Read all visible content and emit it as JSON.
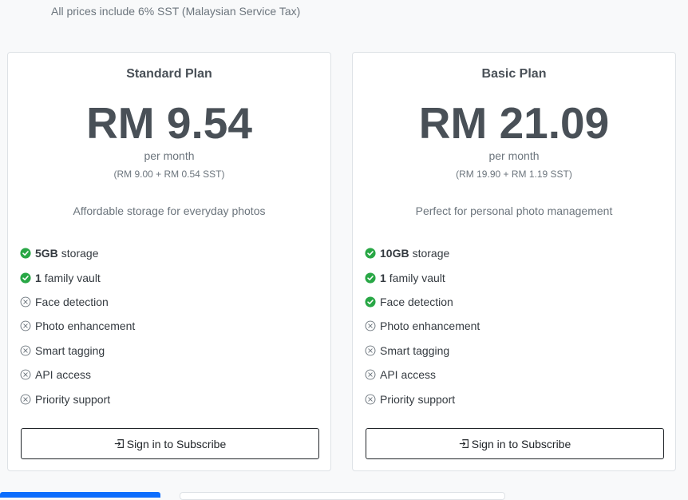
{
  "tax_note": "All prices include 6% SST (Malaysian Service Tax)",
  "colors": {
    "check": "#28a745",
    "muted": "#6c757d",
    "primary": "#0d6efd"
  },
  "plans": [
    {
      "name": "Standard Plan",
      "price": "RM 9.54",
      "period": "per month",
      "breakdown": "(RM 9.00 + RM 0.54 SST)",
      "description": "Affordable storage for everyday photos",
      "features": [
        {
          "bold": "5GB",
          "text": "storage",
          "icon": "check-circle-icon"
        },
        {
          "bold": "1",
          "text": "family vault",
          "icon": "check-circle-icon"
        },
        {
          "bold": "",
          "text": "Face detection",
          "icon": "x-circle-icon"
        },
        {
          "bold": "",
          "text": "Photo enhancement",
          "icon": "x-circle-icon"
        },
        {
          "bold": "",
          "text": "Smart tagging",
          "icon": "x-circle-icon"
        },
        {
          "bold": "",
          "text": "API access",
          "icon": "x-circle-icon"
        },
        {
          "bold": "",
          "text": "Priority support",
          "icon": "x-circle-icon"
        }
      ],
      "button": "Sign in to Subscribe"
    },
    {
      "name": "Basic Plan",
      "price": "RM 21.09",
      "period": "per month",
      "breakdown": "(RM 19.90 + RM 1.19 SST)",
      "description": "Perfect for personal photo management",
      "features": [
        {
          "bold": "10GB",
          "text": "storage",
          "icon": "check-circle-icon"
        },
        {
          "bold": "1",
          "text": "family vault",
          "icon": "check-circle-icon"
        },
        {
          "bold": "",
          "text": "Face detection",
          "icon": "check-circle-icon"
        },
        {
          "bold": "",
          "text": "Photo enhancement",
          "icon": "x-circle-icon"
        },
        {
          "bold": "",
          "text": "Smart tagging",
          "icon": "x-circle-icon"
        },
        {
          "bold": "",
          "text": "API access",
          "icon": "x-circle-icon"
        },
        {
          "bold": "",
          "text": "Priority support",
          "icon": "x-circle-icon"
        }
      ],
      "button": "Sign in to Subscribe"
    }
  ]
}
